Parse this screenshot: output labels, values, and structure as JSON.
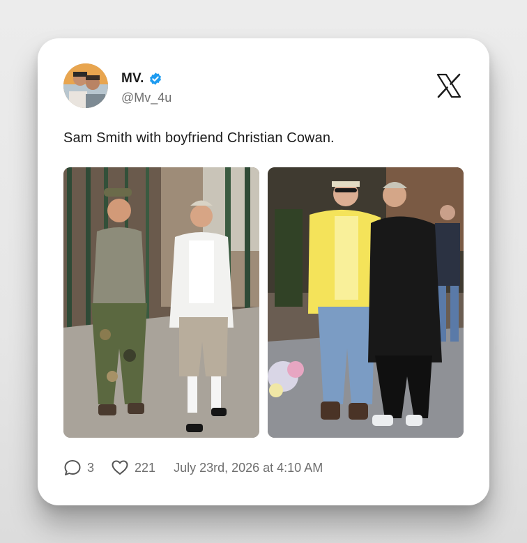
{
  "post": {
    "author_name": "MV.",
    "author_handle": "@Mv_4u",
    "verified": true,
    "text": "Sam Smith with boyfriend Christian Cowan.",
    "replies": "3",
    "likes": "221",
    "timestamp": "July 23rd, 2026 at 4:10 AM"
  },
  "icons": {
    "verified": "verified-badge-icon",
    "platform": "x-logo-icon",
    "reply": "reply-icon",
    "like": "heart-icon"
  },
  "colors": {
    "verified_blue": "#1d9bf0",
    "card_bg": "#ffffff",
    "muted_text": "#6f6f6f"
  }
}
